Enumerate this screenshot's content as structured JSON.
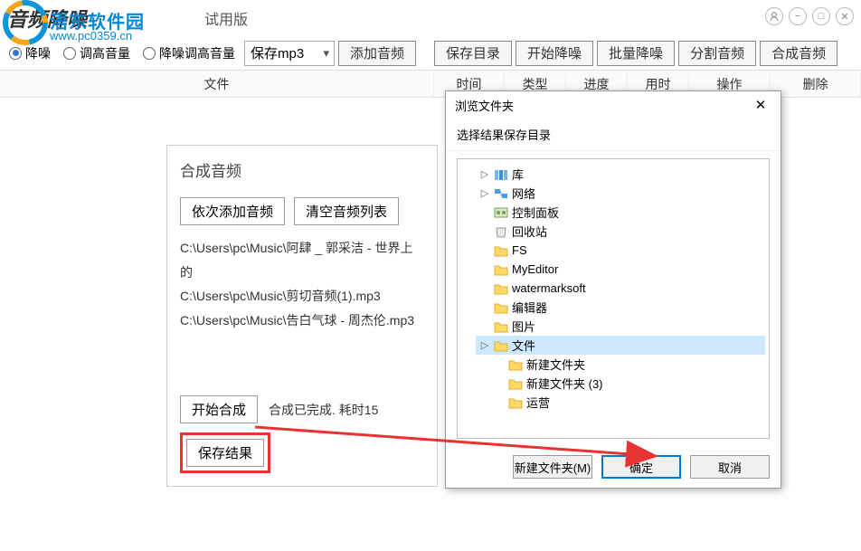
{
  "titlebar": {
    "app_name": "音频降噪",
    "watermark_brand": "浯东软件园",
    "watermark_url": "www.pc0359.cn",
    "trial": "试用版"
  },
  "toolbar": {
    "radio1": "降噪",
    "radio2": "调高音量",
    "radio3": "降噪调高音量",
    "format_select": "保存mp3",
    "add_audio": "添加音频",
    "save_dir": "保存目录",
    "start_denoise": "开始降噪",
    "batch_denoise": "批量降噪",
    "split_audio": "分割音频",
    "merge_audio": "合成音频"
  },
  "table": {
    "file": "文件",
    "time": "时间",
    "type": "类型",
    "progress": "进度",
    "duration": "用时",
    "operate": "操作",
    "delete": "删除"
  },
  "panel": {
    "title": "合成音频",
    "add_seq": "依次添加音频",
    "clear_list": "清空音频列表",
    "files": [
      "C:\\Users\\pc\\Music\\阿肆 _ 郭采洁 - 世界上的",
      "C:\\Users\\pc\\Music\\剪切音频(1).mp3",
      "C:\\Users\\pc\\Music\\告白气球 - 周杰伦.mp3"
    ],
    "start_merge": "开始合成",
    "status": "合成已完成. 耗时15",
    "save_result": "保存结果"
  },
  "dialog": {
    "title": "浏览文件夹",
    "subtitle": "选择结果保存目录",
    "tree": [
      {
        "label": "库",
        "indent": 1,
        "toggle": "▷",
        "icon": "lib"
      },
      {
        "label": "网络",
        "indent": 1,
        "toggle": "▷",
        "icon": "net"
      },
      {
        "label": "控制面板",
        "indent": 1,
        "toggle": "",
        "icon": "cp"
      },
      {
        "label": "回收站",
        "indent": 1,
        "toggle": "",
        "icon": "bin"
      },
      {
        "label": "FS",
        "indent": 1,
        "toggle": "",
        "icon": "folder"
      },
      {
        "label": "MyEditor",
        "indent": 1,
        "toggle": "",
        "icon": "folder"
      },
      {
        "label": "watermarksoft",
        "indent": 1,
        "toggle": "",
        "icon": "folder"
      },
      {
        "label": "编辑器",
        "indent": 1,
        "toggle": "",
        "icon": "folder"
      },
      {
        "label": "图片",
        "indent": 1,
        "toggle": "",
        "icon": "folder"
      },
      {
        "label": "文件",
        "indent": 1,
        "toggle": "▷",
        "icon": "folder",
        "selected": true
      },
      {
        "label": "新建文件夹",
        "indent": 2,
        "toggle": "",
        "icon": "folder"
      },
      {
        "label": "新建文件夹 (3)",
        "indent": 2,
        "toggle": "",
        "icon": "folder"
      },
      {
        "label": "运营",
        "indent": 2,
        "toggle": "",
        "icon": "folder"
      }
    ],
    "new_folder": "新建文件夹(M)",
    "ok": "确定",
    "cancel": "取消"
  }
}
